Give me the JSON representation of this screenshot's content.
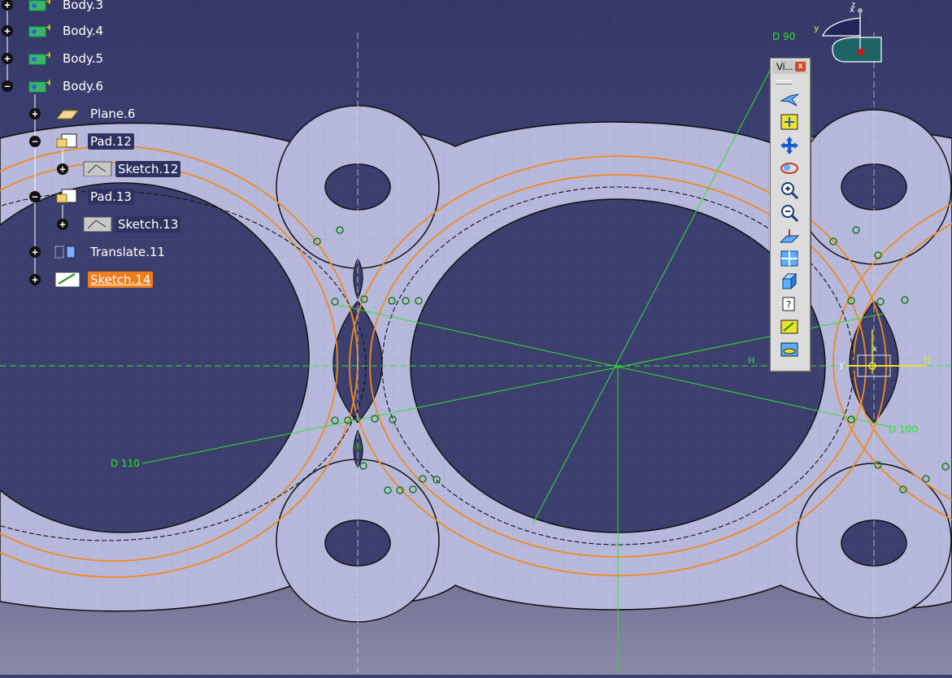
{
  "tree": {
    "items": [
      {
        "label": "Body.3",
        "expander": "+"
      },
      {
        "label": "Body.4",
        "expander": "+"
      },
      {
        "label": "Body.5",
        "expander": "+"
      },
      {
        "label": "Body.6",
        "expander": "−"
      },
      {
        "label": "Plane.6",
        "expander": "+"
      },
      {
        "label": "Pad.12",
        "expander": "−"
      },
      {
        "label": "Sketch.12",
        "expander": "+"
      },
      {
        "label": "Pad.13",
        "expander": "−"
      },
      {
        "label": "Sketch.13",
        "expander": "+"
      },
      {
        "label": "Translate.11",
        "expander": "+"
      },
      {
        "label": "Sketch.14",
        "expander": "+"
      }
    ]
  },
  "dimensions": {
    "d90": "D 90",
    "d100": "D 100",
    "d110": "D 110",
    "h_left": "H",
    "h_right": "H"
  },
  "toolbar": {
    "title": "Vi...",
    "close": "x",
    "buttons": [
      "fly-mode",
      "fit-all-in",
      "pan",
      "rotate",
      "zoom-in",
      "zoom-out",
      "normal-view",
      "multi-view",
      "isometric-view",
      "render-style",
      "hide-show",
      "swap-visible-space"
    ]
  },
  "compass": {
    "z": "z",
    "x": "x",
    "y": "y"
  },
  "axis_labels": {
    "y": "y",
    "x": "x"
  },
  "colors": {
    "background": "#3c3f6e",
    "part_fill": "#b7b9dc",
    "orange_curves": "#f08a22",
    "constraint_green": "#2fe02f",
    "selection": "#f07c1c"
  }
}
